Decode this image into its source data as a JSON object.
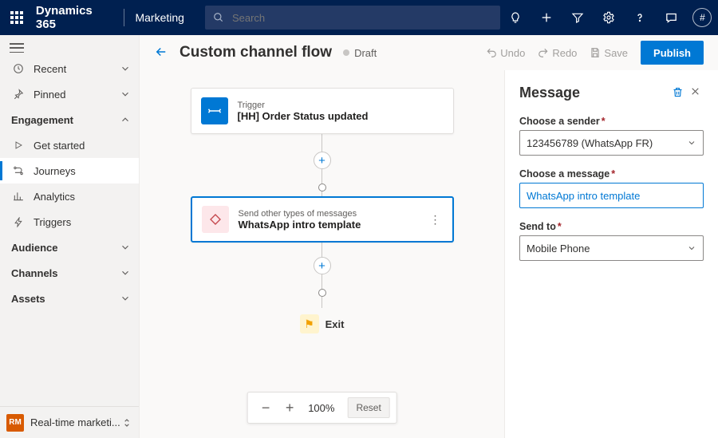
{
  "header": {
    "brand": "Dynamics 365",
    "area": "Marketing",
    "search_placeholder": "Search",
    "avatar_glyph": "#"
  },
  "leftnav": {
    "recent": "Recent",
    "pinned": "Pinned",
    "sections": {
      "engagement": "Engagement",
      "audience": "Audience",
      "channels": "Channels",
      "assets": "Assets"
    },
    "items": {
      "get_started": "Get started",
      "journeys": "Journeys",
      "analytics": "Analytics",
      "triggers": "Triggers"
    },
    "env": {
      "badge": "RM",
      "name": "Real-time marketi..."
    }
  },
  "cmdbar": {
    "title": "Custom channel flow",
    "status": "Draft",
    "undo": "Undo",
    "redo": "Redo",
    "save": "Save",
    "publish": "Publish"
  },
  "canvas": {
    "trigger": {
      "sub": "Trigger",
      "main": "[HH] Order Status updated"
    },
    "message_node": {
      "sub": "Send other types of messages",
      "main": "WhatsApp intro template"
    },
    "exit": "Exit",
    "zoom_pct": "100%",
    "reset": "Reset"
  },
  "panel": {
    "title": "Message",
    "sender_label": "Choose a sender",
    "sender_value": "123456789 (WhatsApp FR)",
    "message_label": "Choose a message",
    "message_value": "WhatsApp intro template",
    "sendto_label": "Send to",
    "sendto_value": "Mobile Phone"
  }
}
